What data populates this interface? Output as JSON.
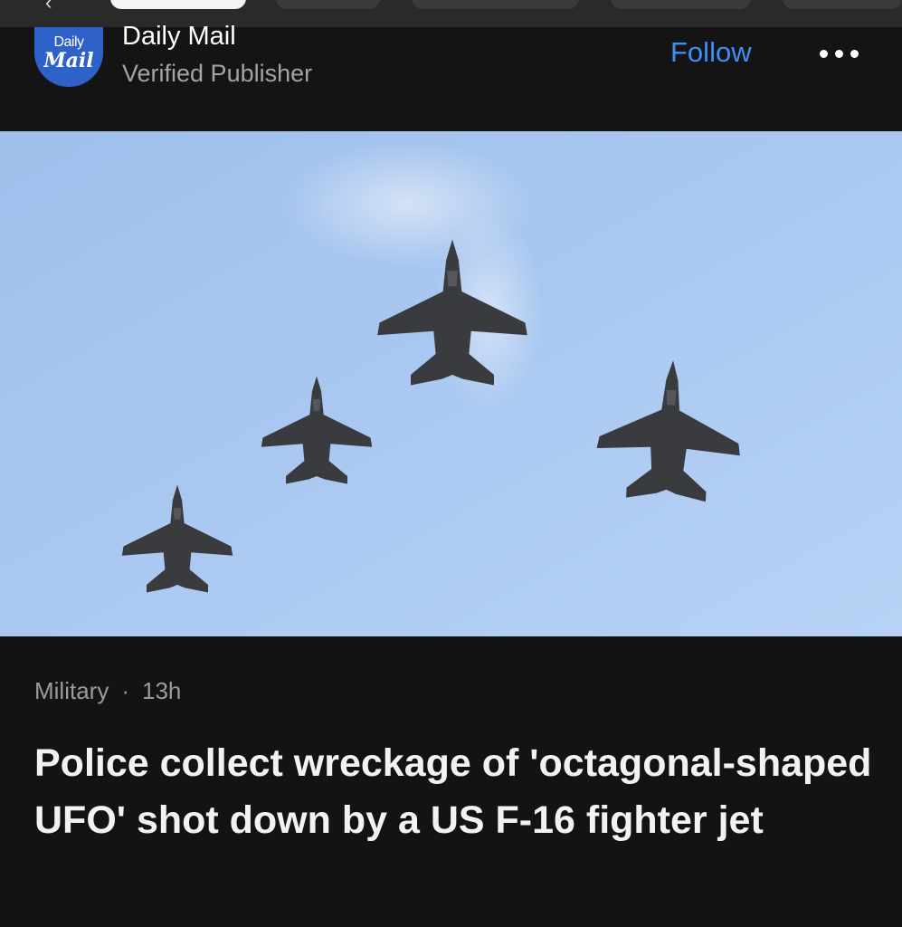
{
  "publisher": {
    "logo_line1": "Daily",
    "logo_line2": "Mail",
    "name": "Daily Mail",
    "subtitle": "Verified Publisher"
  },
  "actions": {
    "follow_label": "Follow",
    "more_icon": "more-horizontal-icon"
  },
  "hero_image": {
    "subject": "four fighter jets in formation against blue sky",
    "sky_color": "#a9c7f0",
    "jet_color": "#3b3c40"
  },
  "article": {
    "category": "Military",
    "separator": "·",
    "age": "13h",
    "headline": "Police collect wreckage of 'octagonal-shaped UFO' shot down by a US F-16 fighter jet"
  }
}
